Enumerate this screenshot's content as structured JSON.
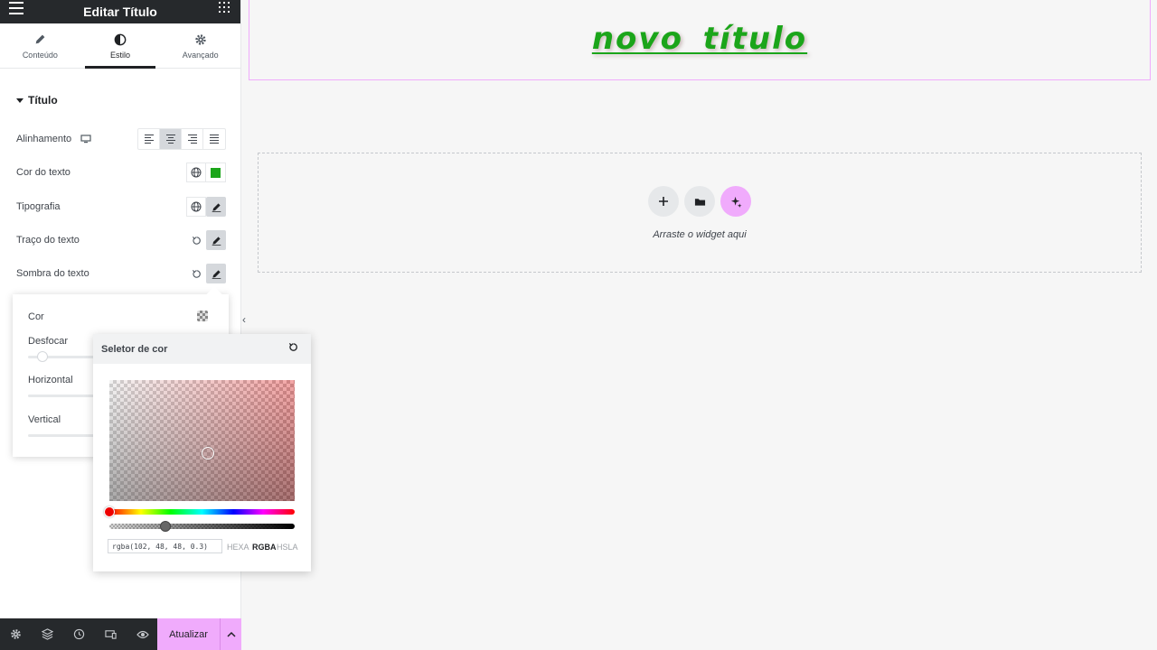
{
  "panel": {
    "title": "Editar Título",
    "tabs": [
      {
        "label": "Conteúdo",
        "icon": "pencil-icon"
      },
      {
        "label": "Estilo",
        "icon": "contrast-icon",
        "active": true
      },
      {
        "label": "Avançado",
        "icon": "gear-icon"
      }
    ],
    "section_title": "Título",
    "controls": {
      "alignment": "Alinhamento",
      "text_color": "Cor do texto",
      "typography": "Tipografia",
      "text_stroke": "Traço do texto",
      "text_shadow": "Sombra do texto"
    },
    "text_color_value": "#1ba51a"
  },
  "shadow_popover": {
    "color_label": "Cor",
    "blur_label": "Desfocar",
    "horizontal_label": "Horizontal",
    "vertical_label": "Vertical"
  },
  "color_picker": {
    "title": "Seletor de cor",
    "value": "rgba(102, 48, 48, 0.3)",
    "alpha": 0.3,
    "formats": [
      "HEXA",
      "RGBA",
      "HSLA"
    ],
    "active_format": "RGBA"
  },
  "bottom_bar": {
    "update_label": "Atualizar",
    "accent_color": "#f0abfc"
  },
  "canvas": {
    "heading": "novo título",
    "heading_color": "#1ba51a",
    "drop_text": "Arraste o widget aqui"
  }
}
